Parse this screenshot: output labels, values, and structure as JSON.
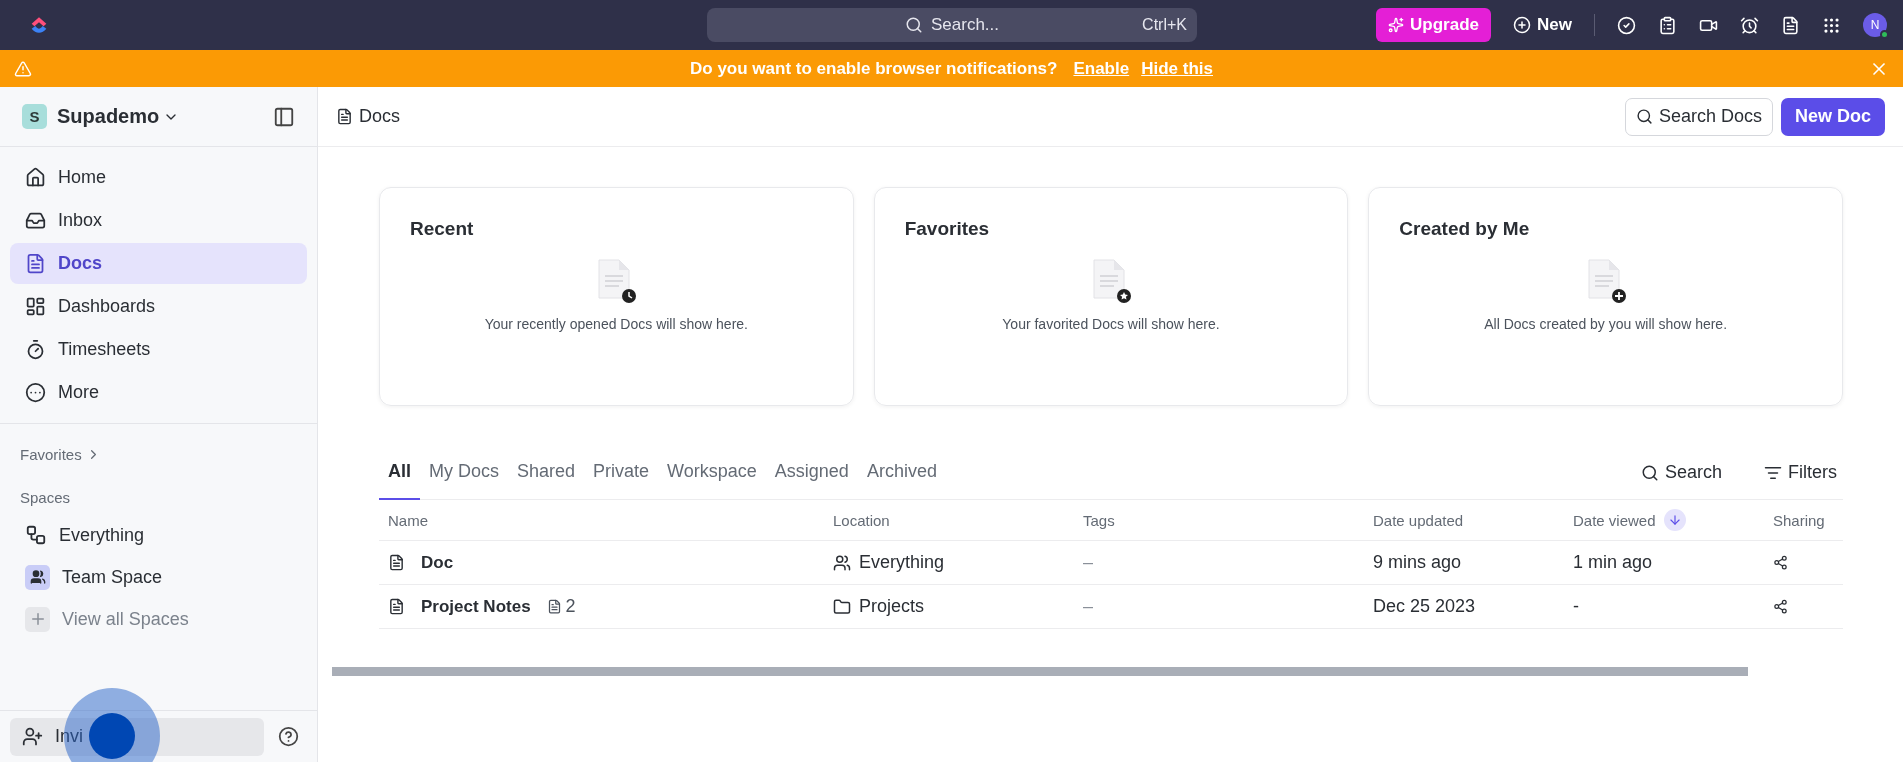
{
  "topbar": {
    "search": {
      "placeholder": "Search...",
      "shortcut": "Ctrl+K"
    },
    "upgrade": "Upgrade",
    "new": "New",
    "avatar": "N"
  },
  "banner": {
    "message": "Do you want to enable browser notifications?",
    "actions": [
      "Enable",
      "Hide this"
    ]
  },
  "sidebar": {
    "workspace": {
      "initial": "S",
      "name": "Supademo"
    },
    "items": [
      {
        "label": "Home",
        "kind": "home",
        "selected": false
      },
      {
        "label": "Inbox",
        "kind": "inbox",
        "selected": false
      },
      {
        "label": "Docs",
        "kind": "docs",
        "selected": true
      },
      {
        "label": "Dashboards",
        "kind": "dashboards",
        "selected": false
      },
      {
        "label": "Timesheets",
        "kind": "timesheets",
        "selected": false
      },
      {
        "label": "More",
        "kind": "more",
        "selected": false
      }
    ],
    "favorites": "Favorites",
    "spaces_heading": "Spaces",
    "spaces": [
      {
        "label": "Everything",
        "kind": "everything"
      },
      {
        "label": "Team Space",
        "kind": "team"
      },
      {
        "label": "View all Spaces",
        "kind": "add"
      }
    ],
    "invite": "Invi"
  },
  "header": {
    "breadcrumb": "Docs",
    "search_button": "Search Docs",
    "new_button": "New Doc"
  },
  "cards": [
    {
      "title": "Recent",
      "message": "Your recently opened Docs will show here.",
      "kind": "clock"
    },
    {
      "title": "Favorites",
      "message": "Your favorited Docs will show here.",
      "kind": "star"
    },
    {
      "title": "Created by Me",
      "message": "All Docs created by you will show here.",
      "kind": "plus"
    }
  ],
  "tabs": [
    {
      "label": "All",
      "selected": true
    },
    {
      "label": "My Docs",
      "selected": false
    },
    {
      "label": "Shared",
      "selected": false
    },
    {
      "label": "Private",
      "selected": false
    },
    {
      "label": "Workspace",
      "selected": false
    },
    {
      "label": "Assigned",
      "selected": false
    },
    {
      "label": "Archived",
      "selected": false
    }
  ],
  "tools": {
    "search": "Search",
    "filters": "Filters"
  },
  "table": {
    "columns": [
      {
        "label": "Name",
        "sorted": false
      },
      {
        "label": "Location",
        "sorted": false
      },
      {
        "label": "Tags",
        "sorted": false
      },
      {
        "label": "Date updated",
        "sorted": false
      },
      {
        "label": "Date viewed",
        "sorted": true
      },
      {
        "label": "Sharing",
        "sorted": false
      }
    ],
    "rows": [
      {
        "name": "Doc",
        "location": {
          "text": "Everything",
          "kind": "people"
        },
        "tags": "–",
        "updated": "9 mins ago",
        "viewed": "1 min ago"
      },
      {
        "name": "Project Notes",
        "subpages": "2",
        "location": {
          "text": "Projects",
          "kind": "folder"
        },
        "tags": "–",
        "updated": "Dec 25 2023",
        "viewed": "-"
      }
    ]
  }
}
